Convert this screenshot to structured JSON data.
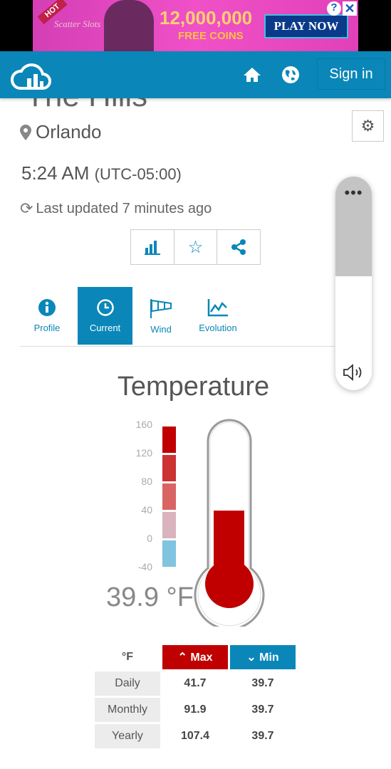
{
  "ad": {
    "badge": "HOT",
    "brand": "Scatter Slots",
    "headline": "12,000,000",
    "subline": "FREE COINS",
    "cta": "PLAY NOW"
  },
  "header": {
    "signin": "Sign in"
  },
  "station": {
    "title": "The Hills",
    "city": "Orlando",
    "time": "5:24 AM",
    "utc": "(UTC-05:00)",
    "updated": "Last updated 7 minutes ago"
  },
  "tabs": [
    {
      "label": "Profile",
      "icon": "info-icon"
    },
    {
      "label": "Current",
      "icon": "clock-icon",
      "active": true
    },
    {
      "label": "Wind",
      "icon": "windsock-icon"
    },
    {
      "label": "Evolution",
      "icon": "line-chart-icon"
    }
  ],
  "temperature": {
    "title": "Temperature",
    "value": 39.9,
    "display": "39.9 °F",
    "scale": [
      "160",
      "120",
      "80",
      "40",
      "0",
      "-40"
    ],
    "scale_min": -40,
    "scale_max": 160,
    "band_colors": [
      "#c00000",
      "#cc3333",
      "#d96464",
      "#d9b3bd",
      "#80c4e0"
    ],
    "fill_color": "#c00000"
  },
  "stats": {
    "unit": "°F",
    "max": "Max",
    "min": "Min",
    "rows": [
      {
        "label": "Daily",
        "max": "41.7",
        "min": "39.7"
      },
      {
        "label": "Monthly",
        "max": "91.9",
        "min": "39.7"
      },
      {
        "label": "Yearly",
        "max": "107.4",
        "min": "39.7"
      }
    ]
  }
}
